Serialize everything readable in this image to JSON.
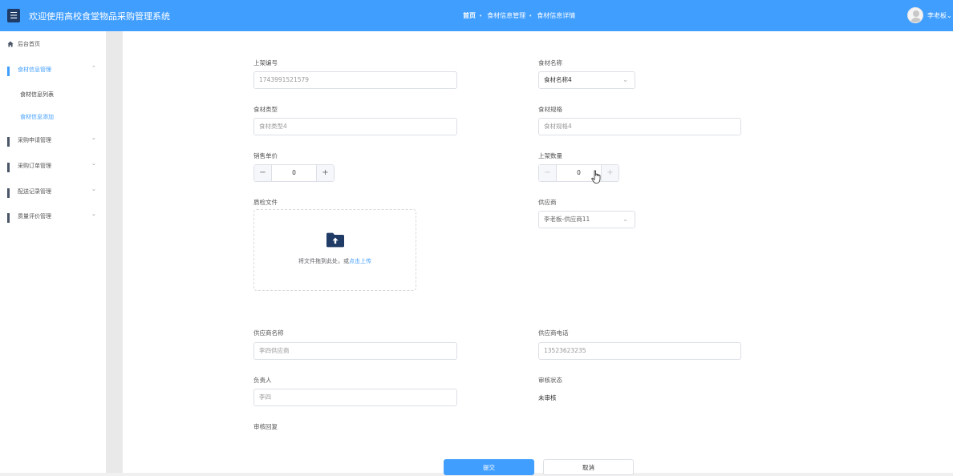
{
  "header": {
    "menu_icon": "hamburger-icon",
    "title": "欢迎使用高校食堂物品采购管理系统",
    "breadcrumbs": [
      "首页",
      "食材信息管理",
      "食材信息详情"
    ],
    "user": "李老板"
  },
  "sidebar": {
    "home": "后台首页",
    "groups": [
      {
        "label": "食材信息管理",
        "expanded": true,
        "children": [
          "食材信息列表",
          "食材信息添加"
        ]
      },
      {
        "label": "采购申请管理"
      },
      {
        "label": "采购订单管理"
      },
      {
        "label": "配送记录管理"
      },
      {
        "label": "质量评价管理"
      }
    ]
  },
  "form": {
    "code_label": "上架编号",
    "code_value": "1743991521579",
    "name_label": "食材名称",
    "name_value": "食材名称4",
    "type_label": "食材类型",
    "type_value": "食材类型4",
    "spec_label": "食材规格",
    "spec_value": "食材规格4",
    "price_label": "销售单价",
    "price_value": "0",
    "qty_label": "上架数量",
    "qty_value": "0",
    "file_label": "质检文件",
    "upload_text": "将文件拖到此处，或",
    "upload_link": "点击上传",
    "supplier_label": "供应商",
    "supplier_value": "李老板-供应商11",
    "supplier_name_label": "供应商名称",
    "supplier_name_value": "李四供应商",
    "supplier_phone_label": "供应商电话",
    "supplier_phone_value": "13523623235",
    "owner_label": "负责人",
    "owner_value": "李四",
    "review_status_label": "审核状态",
    "review_status_value": "未审核",
    "review_reply_label": "审核回复",
    "submit_label": "提交",
    "cancel_label": "取消"
  },
  "colors": {
    "accent": "#409eff",
    "menu_button": "#1f3b66",
    "upload_icon": "#1f3b66"
  }
}
